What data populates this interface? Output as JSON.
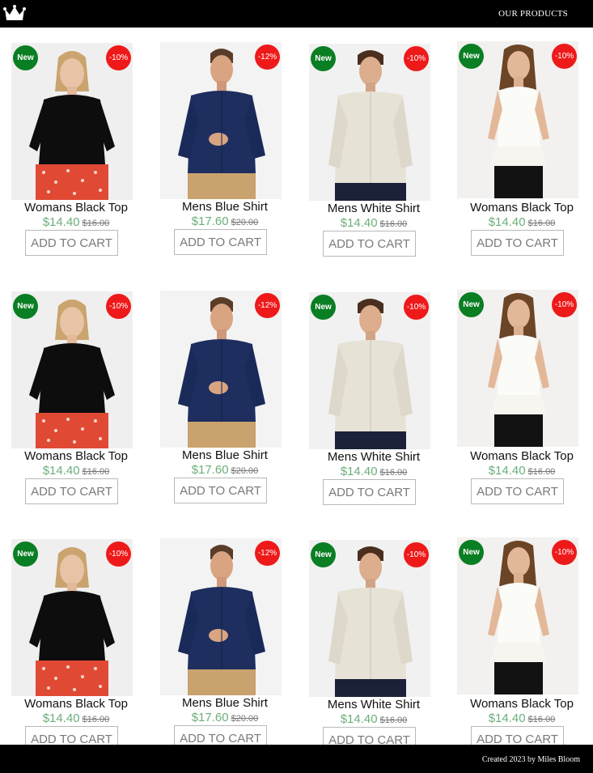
{
  "header": {
    "nav_link": "OUR PRODUCTS",
    "logo_icon": "crown-icon"
  },
  "footer": {
    "text": "Created 2023 by Miles Bloom"
  },
  "colors": {
    "accent_green": "#0a7e23",
    "discount_red": "#ee1a1a",
    "price_green": "#6cae7a",
    "bar_black": "#000000"
  },
  "products": [
    {
      "name": "Womans Black Top",
      "price": "$14.40",
      "old_price": "$16.00",
      "new_badge": "New",
      "discount": "-10%",
      "button": "ADD TO CART",
      "image_icon": "woman-black-top-photo"
    },
    {
      "name": "Mens Blue Shirt",
      "price": "$17.60",
      "old_price": "$20.00",
      "new_badge": "",
      "discount": "-12%",
      "button": "ADD TO CART",
      "image_icon": "man-blue-shirt-photo"
    },
    {
      "name": "Mens White Shirt",
      "price": "$14.40",
      "old_price": "$16.00",
      "new_badge": "New",
      "discount": "-10%",
      "button": "ADD TO CART",
      "image_icon": "man-white-shirt-photo"
    },
    {
      "name": "Womans Black Top",
      "price": "$14.40",
      "old_price": "$16.00",
      "new_badge": "New",
      "discount": "-10%",
      "button": "ADD TO CART",
      "image_icon": "woman-white-top-photo"
    },
    {
      "name": "Womans Black Top",
      "price": "$14.40",
      "old_price": "$16.00",
      "new_badge": "New",
      "discount": "-10%",
      "button": "ADD TO CART",
      "image_icon": "woman-black-top-photo"
    },
    {
      "name": "Mens Blue Shirt",
      "price": "$17.60",
      "old_price": "$20.00",
      "new_badge": "",
      "discount": "-12%",
      "button": "ADD TO CART",
      "image_icon": "man-blue-shirt-photo"
    },
    {
      "name": "Mens White Shirt",
      "price": "$14.40",
      "old_price": "$16.00",
      "new_badge": "New",
      "discount": "-10%",
      "button": "ADD TO CART",
      "image_icon": "man-white-shirt-photo"
    },
    {
      "name": "Womans Black Top",
      "price": "$14.40",
      "old_price": "$16.00",
      "new_badge": "New",
      "discount": "-10%",
      "button": "ADD TO CART",
      "image_icon": "woman-white-top-photo"
    },
    {
      "name": "Womans Black Top",
      "price": "$14.40",
      "old_price": "$16.00",
      "new_badge": "New",
      "discount": "-10%",
      "button": "ADD TO CART",
      "image_icon": "woman-black-top-photo"
    },
    {
      "name": "Mens Blue Shirt",
      "price": "$17.60",
      "old_price": "$20.00",
      "new_badge": "",
      "discount": "-12%",
      "button": "ADD TO CART",
      "image_icon": "man-blue-shirt-photo"
    },
    {
      "name": "Mens White Shirt",
      "price": "$14.40",
      "old_price": "$16.00",
      "new_badge": "New",
      "discount": "-10%",
      "button": "ADD TO CART",
      "image_icon": "man-white-shirt-photo"
    },
    {
      "name": "Womans Black Top",
      "price": "$14.40",
      "old_price": "$16.00",
      "new_badge": "New",
      "discount": "-10%",
      "button": "ADD TO CART",
      "image_icon": "woman-white-top-photo"
    }
  ]
}
